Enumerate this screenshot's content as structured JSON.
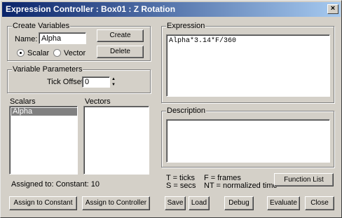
{
  "window": {
    "title": "Expression Controller : Box01 : Z Rotation",
    "close_glyph": "×"
  },
  "create_variables": {
    "group_label": "Create Variables",
    "name_label": "Name:",
    "name_value": "Alpha",
    "create_button": "Create",
    "delete_button": "Delete",
    "scalar_label": "Scalar",
    "vector_label": "Vector",
    "selected_type": "Scalar"
  },
  "variable_parameters": {
    "group_label": "Variable Parameters",
    "tick_offset_label": "Tick Offset:",
    "tick_offset_value": "0",
    "spinner_up": "▲",
    "spinner_down": "▼"
  },
  "lists": {
    "scalars_label": "Scalars",
    "scalars_items": [
      "Alpha"
    ],
    "vectors_label": "Vectors",
    "vectors_items": []
  },
  "assigned_to": "Assigned to:  Constant: 10",
  "buttons": {
    "assign_constant": "Assign to Constant",
    "assign_controller": "Assign to Controller",
    "save": "Save",
    "load": "Load",
    "debug": "Debug",
    "evaluate": "Evaluate",
    "close": "Close",
    "function_list": "Function List"
  },
  "expression": {
    "group_label": "Expression",
    "value": "Alpha*3.14*F/360"
  },
  "description": {
    "group_label": "Description",
    "value": ""
  },
  "legend": {
    "ticks": "T = ticks",
    "secs": "S = secs",
    "frames": "F = frames",
    "normalized": "NT = normalized time"
  },
  "colors": {
    "titlebar_start": "#0a246a",
    "titlebar_end": "#a6caf0",
    "face": "#d4d0c8"
  }
}
